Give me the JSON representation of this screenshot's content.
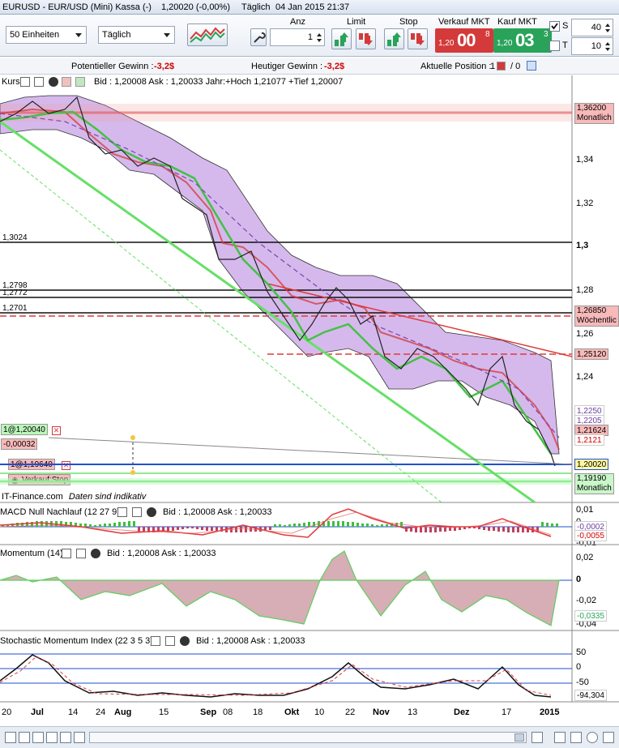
{
  "title": {
    "instrument": "EURUSD - EUR/USD (Mini) Kassa (-)",
    "price_change": "1,20020 (-0,00%)",
    "period": "Täglich",
    "datetime": "04 Jan 2015 21:37"
  },
  "toolbar": {
    "units_select": "50 Einheiten",
    "period_select": "Täglich",
    "qty_label": "Anz",
    "qty_value": "1",
    "limit_label": "Limit",
    "stop_label": "Stop",
    "sell_label": "Verkauf MKT",
    "sell_small": "1,20",
    "sell_big": "00",
    "sell_sup": "8",
    "buy_label": "Kauf MKT",
    "buy_small": "1,20",
    "buy_big": "03",
    "buy_sup": "3",
    "s_label": "S",
    "s_value": "40",
    "t_label": "T",
    "t_value": "10",
    "sell_color": "#d43a3a",
    "buy_color": "#2aa35a"
  },
  "info": {
    "potential_label": "Potentieller Gewinn :",
    "potential_value": "-3,2$",
    "today_label": "Heutiger Gewinn :",
    "today_value": "-3,2$",
    "position_label": "Aktuelle Position :",
    "position_value": "1",
    "position_zero": "/ 0"
  },
  "price_pane": {
    "header_prefix": "Kurs",
    "header_text": "Bid : 1,20008 Ask : 1,20033 Jahr:+Hoch 1,21077 +Tief 1,20007",
    "y_ticks": [
      "1,34",
      "1,32",
      "1,3",
      "1,28",
      "1,26",
      "1,24"
    ],
    "left_labels": [
      "1,3024",
      "1,2798",
      "1,2772",
      "1,2701"
    ],
    "right_tags": [
      {
        "text": "1,36200",
        "sub": "Monatlich"
      },
      {
        "text": "1,26850",
        "sub": "Wöchentlic"
      },
      {
        "text": "1,25120",
        "sub": ""
      },
      {
        "text": "1,2250",
        "sub": ""
      },
      {
        "text": "1,2205",
        "sub": ""
      },
      {
        "text": "1,21624",
        "sub": ""
      },
      {
        "text": "1,2121",
        "sub": ""
      },
      {
        "text": "1,20020",
        "sub": ""
      },
      {
        "text": "1,19190",
        "sub": "Monatlich"
      }
    ],
    "order_tag_1": "1@1,20040",
    "order_tag_2": "-0,00032",
    "order_tag_3": "1@1,19640",
    "stop_tag": "Verkauf:Stop",
    "footer": "IT-Finance.com",
    "footer_note": "Daten sind indikativ"
  },
  "macd_pane": {
    "name": "MACD Null Nachlauf (12 27 9)",
    "quote": "Bid : 1,20008 Ask : 1,20033",
    "y_ticks": [
      "0,01",
      "0",
      "-0,01"
    ],
    "tags": [
      "-0,0002",
      "-0,0055"
    ]
  },
  "momentum_pane": {
    "name": "Momentum (14)",
    "quote": "Bid : 1,20008 Ask : 1,20033",
    "y_ticks": [
      "0,02",
      "0",
      "-0,02",
      "-0,04"
    ],
    "tag": "-0,0335"
  },
  "smi_pane": {
    "name": "Stochastic Momentum Index (22 3 5 3)",
    "quote": "Bid : 1,20008 Ask : 1,20033",
    "y_ticks": [
      "50",
      "0",
      "-50"
    ],
    "tag": "-94,304"
  },
  "x_axis": [
    "20",
    "Jul",
    "14",
    "24",
    "Aug",
    "15",
    "Sep",
    "08",
    "18",
    "Okt",
    "10",
    "22",
    "Nov",
    "13",
    "Dez",
    "17",
    "2015"
  ]
}
